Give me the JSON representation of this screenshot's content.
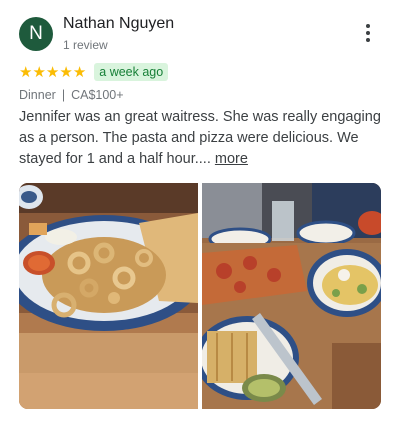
{
  "reviewer": {
    "avatar_initial": "N",
    "name": "Nathan Nguyen",
    "review_count": "1 review"
  },
  "icons": {
    "more": "more-vert-icon",
    "star": "star-icon"
  },
  "rating": {
    "stars": 5,
    "max_stars": 5,
    "time_ago": "a week ago"
  },
  "colors": {
    "avatar_bg": "#1e5a3c",
    "star": "#fbbc04",
    "badge_bg": "#d9f4dd",
    "badge_text": "#188038"
  },
  "meta": {
    "meal": "Dinner",
    "separator": "|",
    "price": "CA$100+"
  },
  "review": {
    "text": "Jennifer was an great waitress. She was really engaging as a person. The pasta and pizza were delicious. We stayed for 1 and a half hour....",
    "more_label": "more"
  },
  "photos": {
    "count": 2
  }
}
